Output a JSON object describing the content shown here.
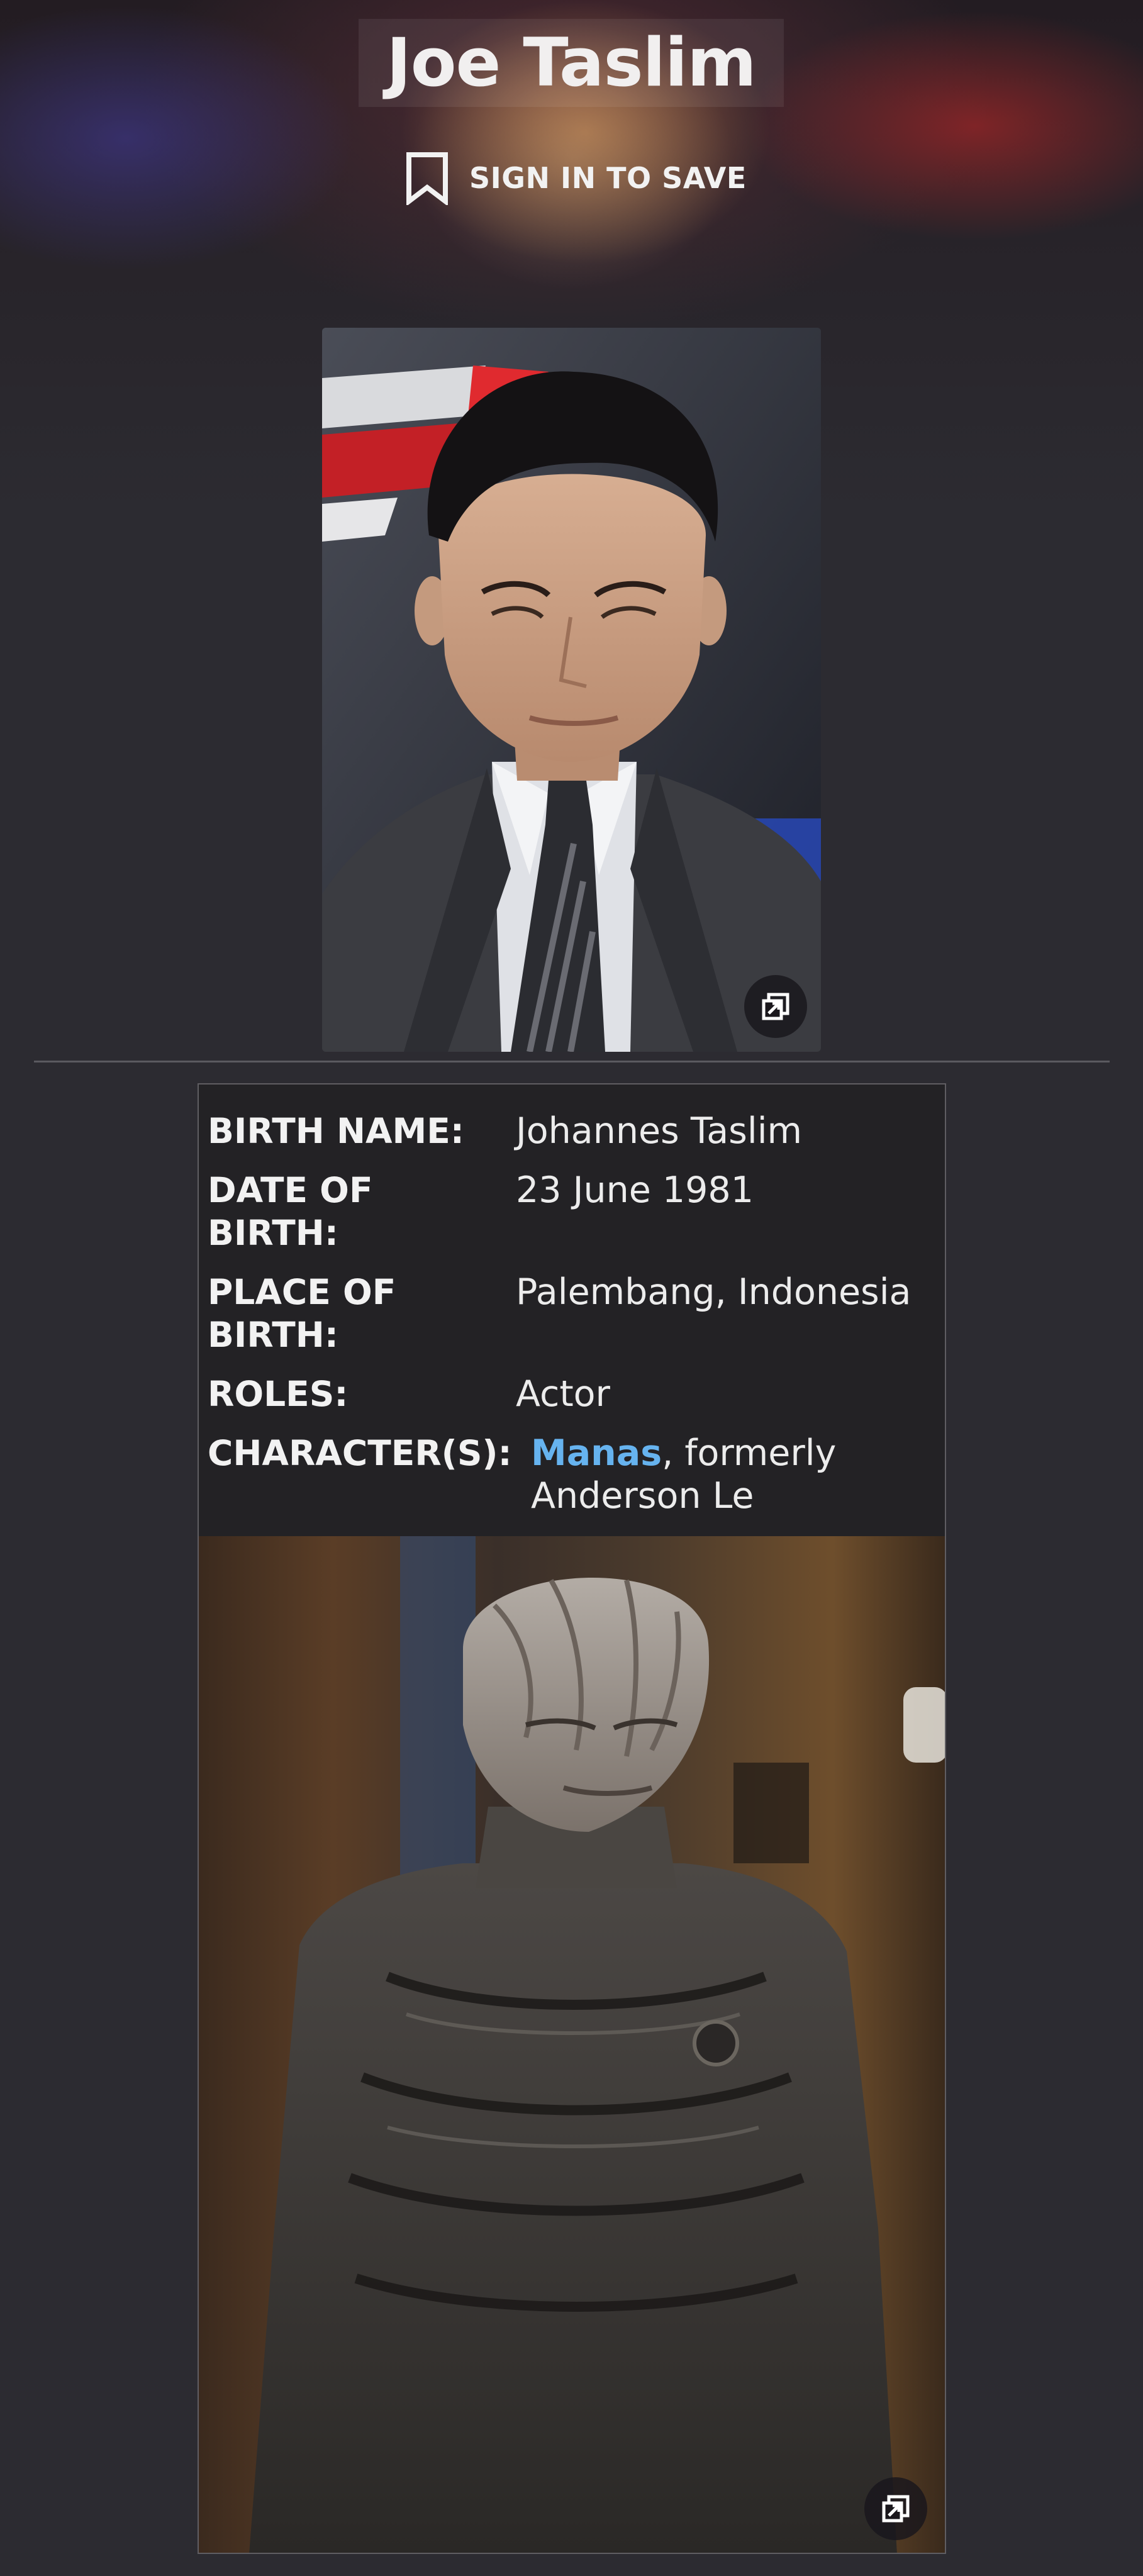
{
  "header": {
    "title": "Joe Taslim",
    "save_label": "SIGN IN TO SAVE"
  },
  "portrait": {
    "icon": "expand-icon"
  },
  "details": {
    "birth_name_label": "BIRTH NAME:",
    "birth_name_value": "Johannes Taslim",
    "dob_label_1": "DATE OF",
    "dob_label_2": "BIRTH:",
    "dob_value": "23 June 1981",
    "pob_label_1": "PLACE OF",
    "pob_label_2": "BIRTH:",
    "pob_value": "Palembang, Indonesia",
    "roles_label": "ROLES:",
    "roles_value": "Actor",
    "characters_label": "CHARACTER(S):",
    "character_link": "Manas",
    "character_suffix": ", formerly",
    "character_line2": "Anderson Le"
  },
  "colors": {
    "link": "#66b3ef",
    "background": "#2c2b31",
    "panel": "#232225"
  }
}
